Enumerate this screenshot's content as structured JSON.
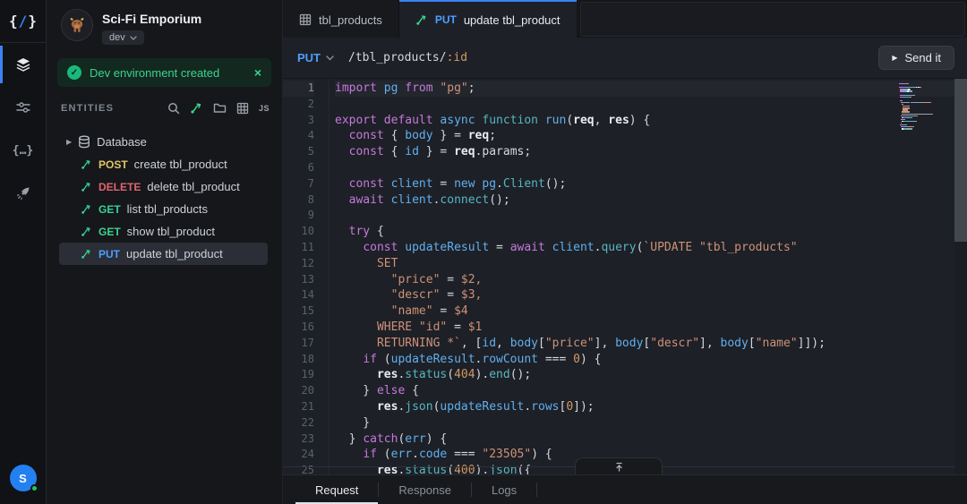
{
  "brand": {
    "logo_left": "{",
    "logo_slash": "/",
    "logo_right": "}"
  },
  "rail": {
    "items": [
      {
        "icon": "layers-icon",
        "active": true
      },
      {
        "icon": "sliders-icon",
        "active": false
      },
      {
        "icon": "code-braces-icon",
        "active": false,
        "glyph": "{…}"
      },
      {
        "icon": "rocket-icon",
        "active": false
      }
    ],
    "avatar_initial": "S"
  },
  "sidebar": {
    "project": {
      "title": "Sci-Fi Emporium",
      "env": "dev"
    },
    "toast": {
      "check": "✓",
      "message": "Dev environment created",
      "close": "×"
    },
    "entities": {
      "label": "ENTITIES",
      "toolbar_icons": [
        "search-icon",
        "add-endpoint-icon",
        "folder-icon",
        "table-icon",
        "js-icon"
      ],
      "js_badge": "JS"
    },
    "tree": [
      {
        "type": "group",
        "caret": "▶",
        "label": "Database"
      },
      {
        "type": "endpoint",
        "method": "POST",
        "label": "create tbl_product"
      },
      {
        "type": "endpoint",
        "method": "DELETE",
        "label": "delete tbl_product"
      },
      {
        "type": "endpoint",
        "method": "GET",
        "label": "list tbl_products"
      },
      {
        "type": "endpoint",
        "method": "GET",
        "label": "show tbl_product"
      },
      {
        "type": "endpoint",
        "method": "PUT",
        "label": "update tbl_product",
        "selected": true
      }
    ]
  },
  "tabs": [
    {
      "label": "tbl_products",
      "icon": "table-icon",
      "active": false
    },
    {
      "method": "PUT",
      "label": "update tbl_product",
      "icon": "endpoint-icon",
      "active": true
    }
  ],
  "request_bar": {
    "method": "PUT",
    "path": "/tbl_products/",
    "path_param": ":id",
    "send_label": "Send it",
    "play_glyph": "▶"
  },
  "editor": {
    "active_line": 1,
    "lines": [
      [
        [
          "k",
          "import "
        ],
        [
          "v",
          "pg "
        ],
        [
          "k",
          "from "
        ],
        [
          "s",
          "\"pg\""
        ],
        [
          "p",
          ";"
        ]
      ],
      [],
      [
        [
          "k",
          "export "
        ],
        [
          "k",
          "default "
        ],
        [
          "v",
          "async "
        ],
        [
          "f",
          "function "
        ],
        [
          "v",
          "run"
        ],
        [
          "p",
          "("
        ],
        [
          "b",
          "req"
        ],
        [
          "p",
          ", "
        ],
        [
          "b",
          "res"
        ],
        [
          "p",
          ") {"
        ]
      ],
      [
        [
          "p",
          "  "
        ],
        [
          "k",
          "const "
        ],
        [
          "p",
          "{ "
        ],
        [
          "v",
          "body"
        ],
        [
          "p",
          " } = "
        ],
        [
          "b",
          "req"
        ],
        [
          "p",
          ";"
        ]
      ],
      [
        [
          "p",
          "  "
        ],
        [
          "k",
          "const "
        ],
        [
          "p",
          "{ "
        ],
        [
          "v",
          "id"
        ],
        [
          "p",
          " } = "
        ],
        [
          "b",
          "req"
        ],
        [
          "p",
          ".params;"
        ]
      ],
      [],
      [
        [
          "p",
          "  "
        ],
        [
          "k",
          "const "
        ],
        [
          "v",
          "client"
        ],
        [
          "p",
          " = "
        ],
        [
          "v",
          "new "
        ],
        [
          "v",
          "pg"
        ],
        [
          "p",
          "."
        ],
        [
          "f",
          "Client"
        ],
        [
          "p",
          "();"
        ]
      ],
      [
        [
          "p",
          "  "
        ],
        [
          "k",
          "await "
        ],
        [
          "v",
          "client"
        ],
        [
          "p",
          "."
        ],
        [
          "f",
          "connect"
        ],
        [
          "p",
          "();"
        ]
      ],
      [],
      [
        [
          "p",
          "  "
        ],
        [
          "k",
          "try "
        ],
        [
          "p",
          "{"
        ]
      ],
      [
        [
          "p",
          "    "
        ],
        [
          "k",
          "const "
        ],
        [
          "v",
          "updateResult"
        ],
        [
          "p",
          " = "
        ],
        [
          "k",
          "await "
        ],
        [
          "v",
          "client"
        ],
        [
          "p",
          "."
        ],
        [
          "f",
          "query"
        ],
        [
          "p",
          "("
        ],
        [
          "s",
          "`UPDATE \"tbl_products\""
        ]
      ],
      [
        [
          "s",
          "      SET"
        ]
      ],
      [
        [
          "s",
          "        \"price\" "
        ],
        [
          "p",
          "= "
        ],
        [
          "s",
          "$2,"
        ]
      ],
      [
        [
          "s",
          "        \"descr\" "
        ],
        [
          "p",
          "= "
        ],
        [
          "s",
          "$3,"
        ]
      ],
      [
        [
          "s",
          "        \"name\" "
        ],
        [
          "p",
          "= "
        ],
        [
          "s",
          "$4"
        ]
      ],
      [
        [
          "s",
          "      WHERE \"id\" "
        ],
        [
          "p",
          "= "
        ],
        [
          "s",
          "$1"
        ]
      ],
      [
        [
          "s",
          "      RETURNING *`"
        ],
        [
          "p",
          ", ["
        ],
        [
          "v",
          "id"
        ],
        [
          "p",
          ", "
        ],
        [
          "v",
          "body"
        ],
        [
          "p",
          "["
        ],
        [
          "s",
          "\"price\""
        ],
        [
          "p",
          "], "
        ],
        [
          "v",
          "body"
        ],
        [
          "p",
          "["
        ],
        [
          "s",
          "\"descr\""
        ],
        [
          "p",
          "], "
        ],
        [
          "v",
          "body"
        ],
        [
          "p",
          "["
        ],
        [
          "s",
          "\"name\""
        ],
        [
          "p",
          "]]);"
        ]
      ],
      [
        [
          "p",
          "    "
        ],
        [
          "k",
          "if "
        ],
        [
          "p",
          "("
        ],
        [
          "v",
          "updateResult"
        ],
        [
          "p",
          "."
        ],
        [
          "v",
          "rowCount"
        ],
        [
          "p",
          " === "
        ],
        [
          "n",
          "0"
        ],
        [
          "p",
          ") {"
        ]
      ],
      [
        [
          "p",
          "      "
        ],
        [
          "b",
          "res"
        ],
        [
          "p",
          "."
        ],
        [
          "f",
          "status"
        ],
        [
          "p",
          "("
        ],
        [
          "n",
          "404"
        ],
        [
          "p",
          ")."
        ],
        [
          "f",
          "end"
        ],
        [
          "p",
          "();"
        ]
      ],
      [
        [
          "p",
          "    } "
        ],
        [
          "k",
          "else "
        ],
        [
          "p",
          "{"
        ]
      ],
      [
        [
          "p",
          "      "
        ],
        [
          "b",
          "res"
        ],
        [
          "p",
          "."
        ],
        [
          "f",
          "json"
        ],
        [
          "p",
          "("
        ],
        [
          "v",
          "updateResult"
        ],
        [
          "p",
          "."
        ],
        [
          "v",
          "rows"
        ],
        [
          "p",
          "["
        ],
        [
          "n",
          "0"
        ],
        [
          "p",
          "]);"
        ]
      ],
      [
        [
          "p",
          "    }"
        ]
      ],
      [
        [
          "p",
          "  } "
        ],
        [
          "k",
          "catch"
        ],
        [
          "p",
          "("
        ],
        [
          "v",
          "err"
        ],
        [
          "p",
          ") {"
        ]
      ],
      [
        [
          "p",
          "    "
        ],
        [
          "k",
          "if "
        ],
        [
          "p",
          "("
        ],
        [
          "v",
          "err"
        ],
        [
          "p",
          "."
        ],
        [
          "v",
          "code"
        ],
        [
          "p",
          " === "
        ],
        [
          "s",
          "\"23505\""
        ],
        [
          "p",
          ") {"
        ]
      ],
      [
        [
          "p",
          "      "
        ],
        [
          "b",
          "res"
        ],
        [
          "p",
          "."
        ],
        [
          "f",
          "status"
        ],
        [
          "p",
          "("
        ],
        [
          "n",
          "400"
        ],
        [
          "p",
          ")."
        ],
        [
          "f",
          "json"
        ],
        [
          "p",
          "({"
        ]
      ]
    ]
  },
  "bottom_tabs": [
    {
      "label": "Request",
      "active": true
    },
    {
      "label": "Response",
      "active": false
    },
    {
      "label": "Logs",
      "active": false
    }
  ],
  "colors": {
    "accent_blue": "#3b82f6",
    "method_put": "#4d9fff",
    "method_get": "#3bd391",
    "method_post": "#e3c368",
    "method_delete": "#e0646e",
    "toast_green": "#3bd391",
    "string_orange": "#ce9178",
    "keyword_magenta": "#c678dd"
  }
}
